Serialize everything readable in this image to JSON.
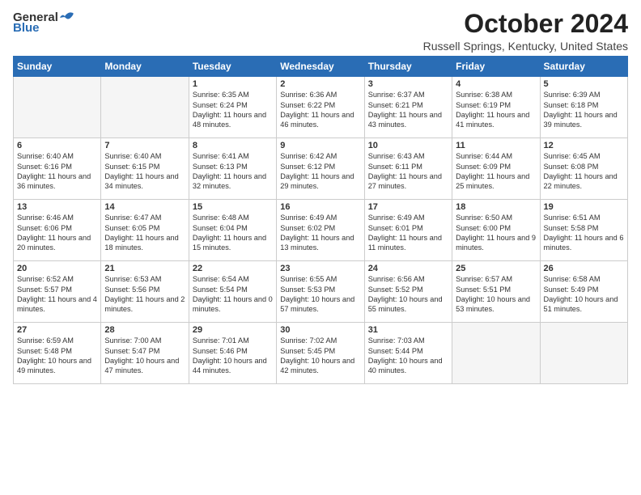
{
  "logo": {
    "general": "General",
    "blue": "Blue"
  },
  "header": {
    "month": "October 2024",
    "location": "Russell Springs, Kentucky, United States"
  },
  "weekdays": [
    "Sunday",
    "Monday",
    "Tuesday",
    "Wednesday",
    "Thursday",
    "Friday",
    "Saturday"
  ],
  "weeks": [
    [
      {
        "day": "",
        "sunrise": "",
        "sunset": "",
        "daylight": ""
      },
      {
        "day": "",
        "sunrise": "",
        "sunset": "",
        "daylight": ""
      },
      {
        "day": "1",
        "sunrise": "Sunrise: 6:35 AM",
        "sunset": "Sunset: 6:24 PM",
        "daylight": "Daylight: 11 hours and 48 minutes."
      },
      {
        "day": "2",
        "sunrise": "Sunrise: 6:36 AM",
        "sunset": "Sunset: 6:22 PM",
        "daylight": "Daylight: 11 hours and 46 minutes."
      },
      {
        "day": "3",
        "sunrise": "Sunrise: 6:37 AM",
        "sunset": "Sunset: 6:21 PM",
        "daylight": "Daylight: 11 hours and 43 minutes."
      },
      {
        "day": "4",
        "sunrise": "Sunrise: 6:38 AM",
        "sunset": "Sunset: 6:19 PM",
        "daylight": "Daylight: 11 hours and 41 minutes."
      },
      {
        "day": "5",
        "sunrise": "Sunrise: 6:39 AM",
        "sunset": "Sunset: 6:18 PM",
        "daylight": "Daylight: 11 hours and 39 minutes."
      }
    ],
    [
      {
        "day": "6",
        "sunrise": "Sunrise: 6:40 AM",
        "sunset": "Sunset: 6:16 PM",
        "daylight": "Daylight: 11 hours and 36 minutes."
      },
      {
        "day": "7",
        "sunrise": "Sunrise: 6:40 AM",
        "sunset": "Sunset: 6:15 PM",
        "daylight": "Daylight: 11 hours and 34 minutes."
      },
      {
        "day": "8",
        "sunrise": "Sunrise: 6:41 AM",
        "sunset": "Sunset: 6:13 PM",
        "daylight": "Daylight: 11 hours and 32 minutes."
      },
      {
        "day": "9",
        "sunrise": "Sunrise: 6:42 AM",
        "sunset": "Sunset: 6:12 PM",
        "daylight": "Daylight: 11 hours and 29 minutes."
      },
      {
        "day": "10",
        "sunrise": "Sunrise: 6:43 AM",
        "sunset": "Sunset: 6:11 PM",
        "daylight": "Daylight: 11 hours and 27 minutes."
      },
      {
        "day": "11",
        "sunrise": "Sunrise: 6:44 AM",
        "sunset": "Sunset: 6:09 PM",
        "daylight": "Daylight: 11 hours and 25 minutes."
      },
      {
        "day": "12",
        "sunrise": "Sunrise: 6:45 AM",
        "sunset": "Sunset: 6:08 PM",
        "daylight": "Daylight: 11 hours and 22 minutes."
      }
    ],
    [
      {
        "day": "13",
        "sunrise": "Sunrise: 6:46 AM",
        "sunset": "Sunset: 6:06 PM",
        "daylight": "Daylight: 11 hours and 20 minutes."
      },
      {
        "day": "14",
        "sunrise": "Sunrise: 6:47 AM",
        "sunset": "Sunset: 6:05 PM",
        "daylight": "Daylight: 11 hours and 18 minutes."
      },
      {
        "day": "15",
        "sunrise": "Sunrise: 6:48 AM",
        "sunset": "Sunset: 6:04 PM",
        "daylight": "Daylight: 11 hours and 15 minutes."
      },
      {
        "day": "16",
        "sunrise": "Sunrise: 6:49 AM",
        "sunset": "Sunset: 6:02 PM",
        "daylight": "Daylight: 11 hours and 13 minutes."
      },
      {
        "day": "17",
        "sunrise": "Sunrise: 6:49 AM",
        "sunset": "Sunset: 6:01 PM",
        "daylight": "Daylight: 11 hours and 11 minutes."
      },
      {
        "day": "18",
        "sunrise": "Sunrise: 6:50 AM",
        "sunset": "Sunset: 6:00 PM",
        "daylight": "Daylight: 11 hours and 9 minutes."
      },
      {
        "day": "19",
        "sunrise": "Sunrise: 6:51 AM",
        "sunset": "Sunset: 5:58 PM",
        "daylight": "Daylight: 11 hours and 6 minutes."
      }
    ],
    [
      {
        "day": "20",
        "sunrise": "Sunrise: 6:52 AM",
        "sunset": "Sunset: 5:57 PM",
        "daylight": "Daylight: 11 hours and 4 minutes."
      },
      {
        "day": "21",
        "sunrise": "Sunrise: 6:53 AM",
        "sunset": "Sunset: 5:56 PM",
        "daylight": "Daylight: 11 hours and 2 minutes."
      },
      {
        "day": "22",
        "sunrise": "Sunrise: 6:54 AM",
        "sunset": "Sunset: 5:54 PM",
        "daylight": "Daylight: 11 hours and 0 minutes."
      },
      {
        "day": "23",
        "sunrise": "Sunrise: 6:55 AM",
        "sunset": "Sunset: 5:53 PM",
        "daylight": "Daylight: 10 hours and 57 minutes."
      },
      {
        "day": "24",
        "sunrise": "Sunrise: 6:56 AM",
        "sunset": "Sunset: 5:52 PM",
        "daylight": "Daylight: 10 hours and 55 minutes."
      },
      {
        "day": "25",
        "sunrise": "Sunrise: 6:57 AM",
        "sunset": "Sunset: 5:51 PM",
        "daylight": "Daylight: 10 hours and 53 minutes."
      },
      {
        "day": "26",
        "sunrise": "Sunrise: 6:58 AM",
        "sunset": "Sunset: 5:49 PM",
        "daylight": "Daylight: 10 hours and 51 minutes."
      }
    ],
    [
      {
        "day": "27",
        "sunrise": "Sunrise: 6:59 AM",
        "sunset": "Sunset: 5:48 PM",
        "daylight": "Daylight: 10 hours and 49 minutes."
      },
      {
        "day": "28",
        "sunrise": "Sunrise: 7:00 AM",
        "sunset": "Sunset: 5:47 PM",
        "daylight": "Daylight: 10 hours and 47 minutes."
      },
      {
        "day": "29",
        "sunrise": "Sunrise: 7:01 AM",
        "sunset": "Sunset: 5:46 PM",
        "daylight": "Daylight: 10 hours and 44 minutes."
      },
      {
        "day": "30",
        "sunrise": "Sunrise: 7:02 AM",
        "sunset": "Sunset: 5:45 PM",
        "daylight": "Daylight: 10 hours and 42 minutes."
      },
      {
        "day": "31",
        "sunrise": "Sunrise: 7:03 AM",
        "sunset": "Sunset: 5:44 PM",
        "daylight": "Daylight: 10 hours and 40 minutes."
      },
      {
        "day": "",
        "sunrise": "",
        "sunset": "",
        "daylight": ""
      },
      {
        "day": "",
        "sunrise": "",
        "sunset": "",
        "daylight": ""
      }
    ]
  ]
}
